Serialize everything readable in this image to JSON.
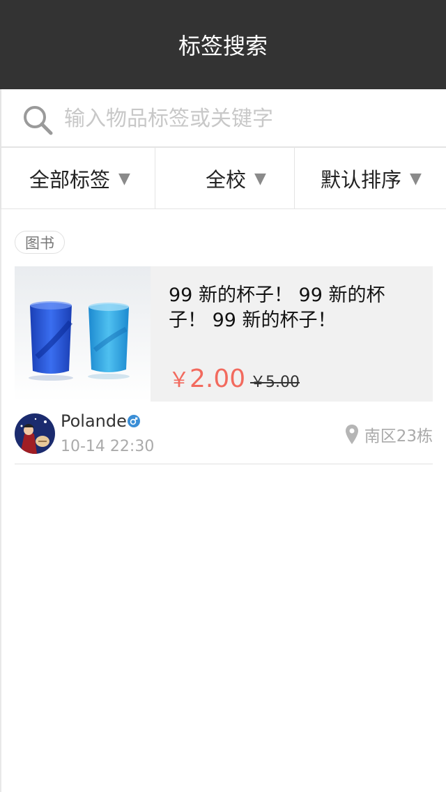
{
  "header": {
    "title": "标签搜索"
  },
  "search": {
    "placeholder": "输入物品标签或关键字",
    "icon": "search-icon"
  },
  "filters": [
    {
      "label": "全部标签",
      "arrow": "▼"
    },
    {
      "label": "全校",
      "arrow": "▼"
    },
    {
      "label": "默认排序",
      "arrow": "▼"
    }
  ],
  "listing": {
    "tag": "图书",
    "title": "99 新的杯子！ 99 新的杯子！ 99 新的杯子！",
    "price_currency": "￥",
    "price": "2.00",
    "old_price": "￥5.00",
    "seller": {
      "name": "Polande",
      "gender": "male",
      "time": "10-14 22:30"
    },
    "location": "南区23栋"
  },
  "colors": {
    "header_bg": "#333333",
    "price": "#f26a5e",
    "gender": "#3a8ed6"
  }
}
